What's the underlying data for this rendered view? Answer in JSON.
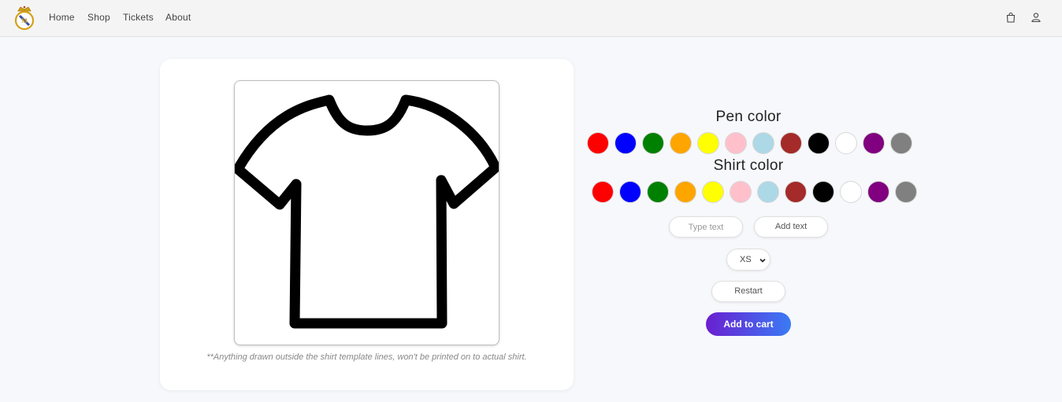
{
  "nav": {
    "links": [
      {
        "label": "Home"
      },
      {
        "label": "Shop"
      },
      {
        "label": "Tickets"
      },
      {
        "label": "About"
      }
    ],
    "icons": [
      "bag-icon",
      "user-icon"
    ]
  },
  "designer": {
    "note": "**Anything drawn outside the shirt template lines, won't be printed on to actual shirt.",
    "pen_color_label": "Pen color",
    "shirt_color_label": "Shirt color",
    "pen_colors": [
      "#ff0000",
      "#0000ff",
      "#008000",
      "#ffa500",
      "#ffff00",
      "#ffc0cb",
      "#add8e6",
      "#a52a2a",
      "#000000",
      "#ffffff",
      "#800080",
      "#808080"
    ],
    "shirt_colors": [
      "#ff0000",
      "#0000ff",
      "#008000",
      "#ffa500",
      "#ffff00",
      "#ffc0cb",
      "#add8e6",
      "#a52a2a",
      "#000000",
      "#ffffff",
      "#800080",
      "#808080"
    ],
    "text_input_placeholder": "Type text",
    "add_text_label": "Add text",
    "size_selected": "XS",
    "restart_label": "Restart",
    "add_to_cart_label": "Add to cart"
  }
}
